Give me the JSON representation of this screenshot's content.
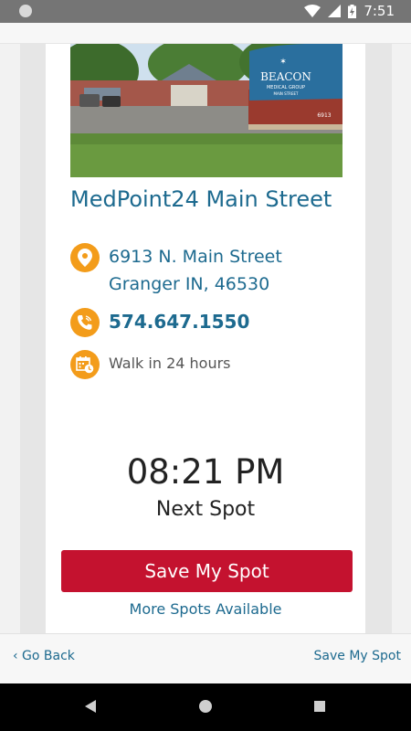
{
  "status_bar": {
    "time": "7:51",
    "icons": [
      "notification-dot-icon",
      "wifi-icon",
      "cell-signal-icon",
      "battery-charging-icon"
    ]
  },
  "clinic": {
    "name": "MedPoint24 Main Street",
    "address_line1": "6913 N. Main Street",
    "address_line2": "Granger IN, 46530",
    "phone": "574.647.1550",
    "walk_in": "Walk in 24 hours",
    "photo_sign": {
      "brand": "BEACON",
      "sub": "MEDICAL GROUP",
      "street": "MAIN STREET",
      "number": "6913"
    }
  },
  "spot": {
    "time": "08:21 PM",
    "label": "Next Spot",
    "save_button": "Save My Spot",
    "more": "More Spots Available"
  },
  "bottom_nav": {
    "back": "‹ Go Back",
    "save": "Save My Spot"
  },
  "colors": {
    "accent_blue": "#1d6a8f",
    "icon_orange": "#f39c1a",
    "button_red": "#c4122f"
  }
}
